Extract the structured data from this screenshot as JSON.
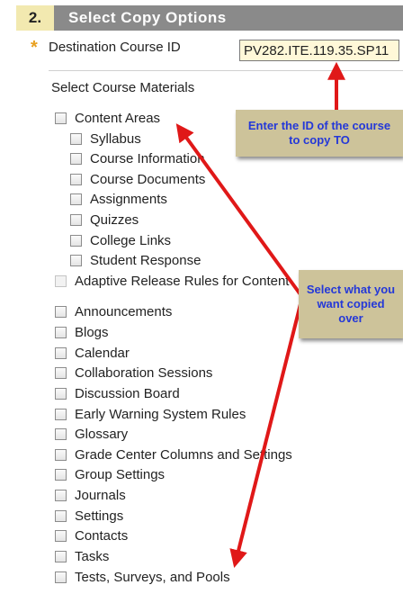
{
  "section": {
    "number": "2.",
    "title": "Select Copy Options"
  },
  "destination": {
    "required_mark": "*",
    "label": "Destination Course ID",
    "value": "PV282.ITE.119.35.SP11"
  },
  "materials_label": "Select Course Materials",
  "content_areas": {
    "parent": "Content Areas",
    "children": [
      "Syllabus",
      "Course Information",
      "Course Documents",
      "Assignments",
      "Quizzes",
      "College Links",
      "Student Response"
    ]
  },
  "adaptive_release": "Adaptive Release Rules for Content",
  "other_items": [
    "Announcements",
    "Blogs",
    "Calendar",
    "Collaboration Sessions",
    "Discussion Board",
    "Early Warning System Rules",
    "Glossary",
    "Grade Center Columns and Settings",
    "Group Settings",
    "Journals",
    "Settings",
    "Contacts",
    "Tasks",
    "Tests, Surveys, and Pools"
  ],
  "callouts": {
    "course_id": "Enter the ID of the course to copy TO",
    "materials": "Select what you want copied over"
  },
  "colors": {
    "arrow": "#e01818",
    "callout_bg": "#cdc39a",
    "callout_text": "#2438d8",
    "header_bg": "#8a8a8a"
  }
}
